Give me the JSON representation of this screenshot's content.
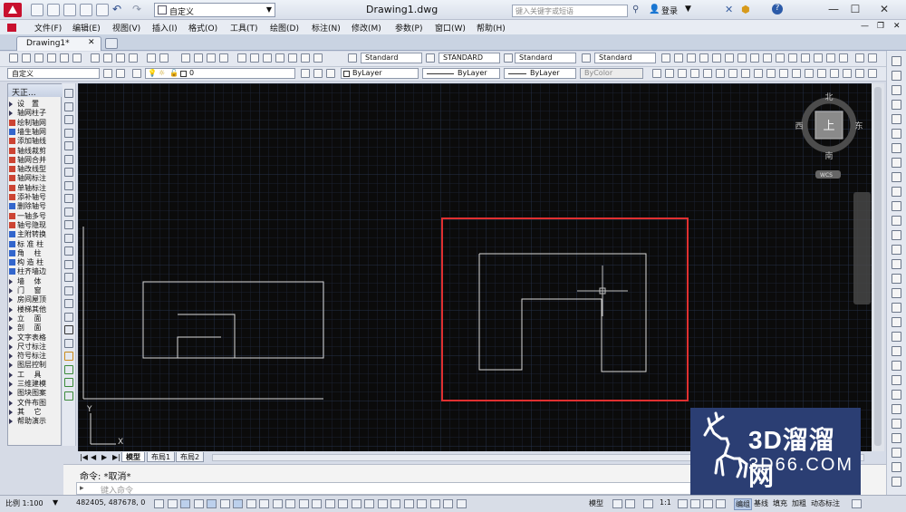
{
  "window": {
    "title": "Drawing1.dwg",
    "workspace": "自定义",
    "search_placeholder": "键入关键字或短语",
    "login": "登录"
  },
  "menu": [
    "文件(F)",
    "编辑(E)",
    "视图(V)",
    "插入(I)",
    "格式(O)",
    "工具(T)",
    "绘图(D)",
    "标注(N)",
    "修改(M)",
    "参数(P)",
    "窗口(W)",
    "帮助(H)"
  ],
  "doc_tab": "Drawing1*",
  "styles": {
    "text_style": "Standard",
    "dim_style": "STANDARD",
    "table_style": "Standard",
    "multileader_style": "Standard"
  },
  "layers": {
    "workspace_combo": "自定义",
    "current_layer": "0",
    "color": "ByLayer",
    "linetype": "ByLayer",
    "lineweight": "ByLayer",
    "plotstyle": "ByColor"
  },
  "tz_panel": {
    "title": "天正...",
    "items": [
      "设　置",
      "轴网柱子",
      "绘制轴网",
      "墙生轴网",
      "添加轴线",
      "轴线裁剪",
      "轴网合并",
      "轴改线型",
      "轴网标注",
      "单轴标注",
      "添补轴号",
      "删除轴号",
      "一轴多号",
      "轴号隐现",
      "主附转换",
      "标 准 柱",
      "角　 柱",
      "构 造 柱",
      "柱齐墙边",
      "墙　 体",
      "门　 窗",
      "房间屋顶",
      "楼梯其他",
      "立　 面",
      "剖　 面",
      "文字表格",
      "尺寸标注",
      "符号标注",
      "图层控制",
      "工　 具",
      "三维建模",
      "图块图案",
      "文件布图",
      "其　 它",
      "帮助演示"
    ]
  },
  "viewcube": {
    "north": "北",
    "south": "南",
    "east": "东",
    "west": "西",
    "top": "上",
    "wcs": "WCS"
  },
  "layout_tabs": [
    "模型",
    "布局1",
    "布局2"
  ],
  "command": {
    "history": "命令: *取消*",
    "placeholder": "键入命令"
  },
  "status": {
    "scale": "比例 1:100",
    "coords": "482405, 487678, 0",
    "model": "模型",
    "anno_scale": "1:1",
    "toggles": [
      "编组",
      "基线",
      "填充",
      "加粗",
      "动态标注"
    ]
  },
  "watermark": {
    "brand": "3D溜溜网",
    "url": "3D66.COM"
  },
  "colors": {
    "canvas": "#0b0b0b",
    "grid": "#1e2636",
    "geometry": "#d8d8d8",
    "selection": "#e03030"
  }
}
